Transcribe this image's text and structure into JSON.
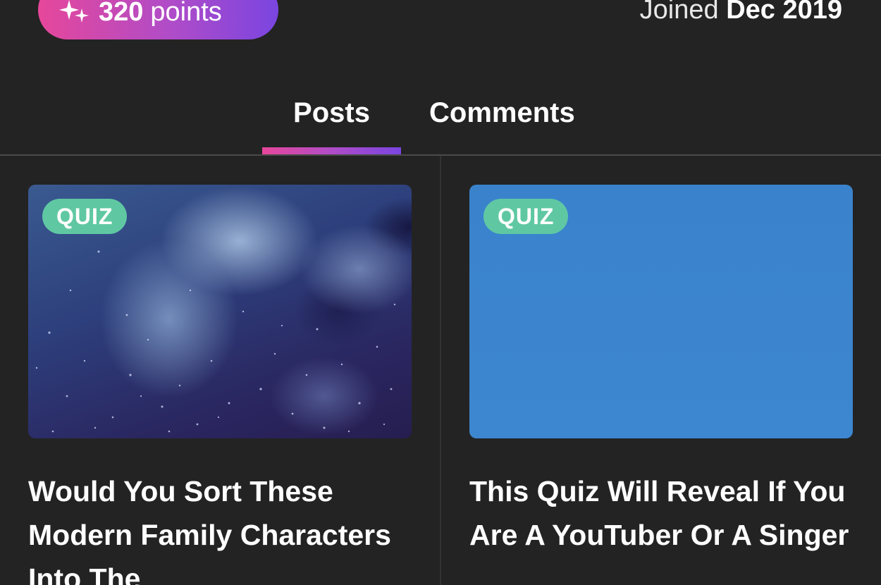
{
  "profile": {
    "points_value": "320",
    "points_unit": "points",
    "points_icon": "sparkle-icon",
    "joined_label": "Joined",
    "joined_date": "Dec 2019"
  },
  "tabs": [
    {
      "label": "Posts",
      "active": true
    },
    {
      "label": "Comments",
      "active": false
    }
  ],
  "posts": [
    {
      "badge": "QUIZ",
      "title": "Would You Sort These Modern Family Characters Into The",
      "thumbnail": "space-nebula-image"
    },
    {
      "badge": "QUIZ",
      "title": "This Quiz Will Reveal If You Are A YouTuber Or A Singer",
      "thumbnail": "blue-sky-image"
    }
  ],
  "colors": {
    "background": "#232323",
    "accent_gradient_start": "#e6479a",
    "accent_gradient_end": "#7a45e0",
    "badge": "#5fc8a3"
  }
}
